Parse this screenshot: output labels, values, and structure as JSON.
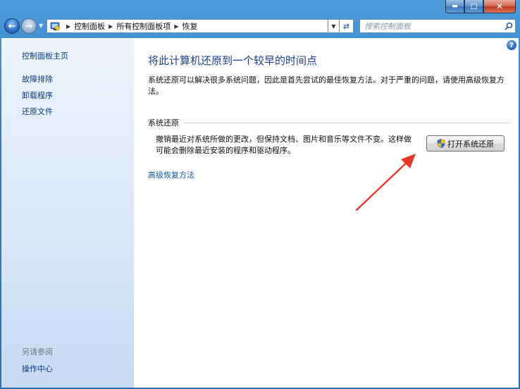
{
  "window": {
    "controls": {
      "minimize": "▬",
      "maximize": "☐",
      "close": "✕"
    },
    "help_glyph": "?"
  },
  "toolbar": {
    "breadcrumb": [
      "控制面板",
      "所有控制面板项",
      "恢复"
    ],
    "search_placeholder": "搜索控制面板"
  },
  "sidebar": {
    "home_link": "控制面板主页",
    "links": [
      "故障排除",
      "卸载程序",
      "还原文件"
    ],
    "see_also_label": "另请参阅",
    "see_also_links": [
      "操作中心"
    ]
  },
  "main": {
    "title": "将此计算机还原到一个较早的时间点",
    "description": "系统还原可以解决很多系统问题，因此是首先尝试的最佳恢复方法。对于严重的问题，请使用高级恢复方法。",
    "system_restore": {
      "group_label": "系统还原",
      "text": "撤销最近对系统所做的更改，但保持文档、图片和音乐等文件不变。这样做可能会删除最近安装的程序和驱动程序。",
      "button_label": "打开系统还原"
    },
    "advanced_link": "高级恢复方法"
  },
  "annotation": {
    "arrow_color": "#e8392c"
  },
  "colors": {
    "link": "#0b3a8a",
    "title": "#1c3f94"
  }
}
